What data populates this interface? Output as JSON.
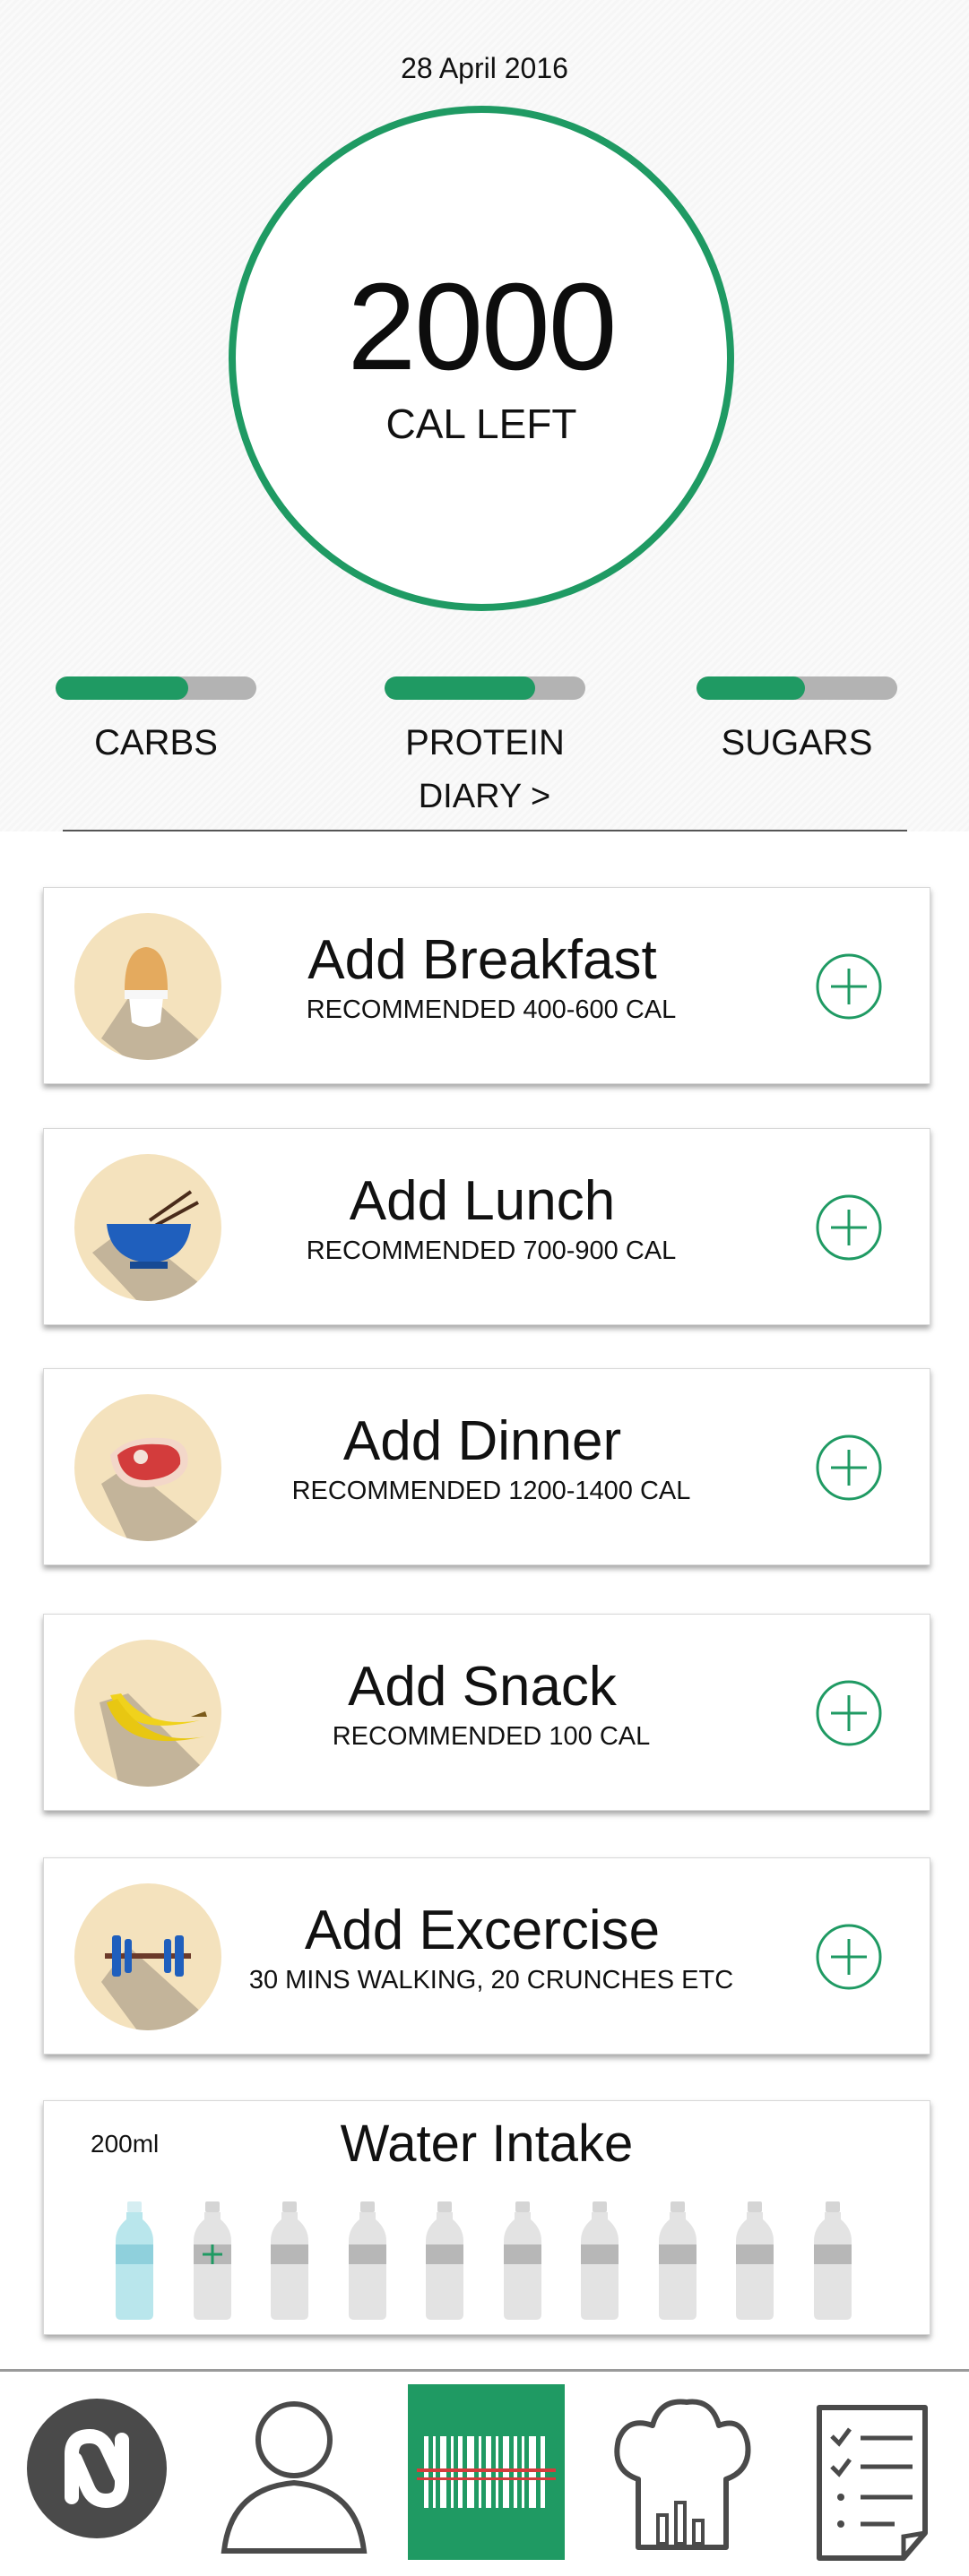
{
  "header": {
    "date": "28 April 2016"
  },
  "calories": {
    "value": "2000",
    "label": "CAL LEFT"
  },
  "macros": [
    {
      "name": "CARBS",
      "progress": 0.66
    },
    {
      "name": "PROTEIN",
      "progress": 0.75
    },
    {
      "name": "SUGARS",
      "progress": 0.54
    }
  ],
  "diary_link": "DIARY >",
  "meals": [
    {
      "title": "Add Breakfast",
      "subtitle": "RECOMMENDED 400-600 CAL",
      "icon": "egg-icon"
    },
    {
      "title": "Add Lunch",
      "subtitle": "RECOMMENDED 700-900 CAL",
      "icon": "bowl-chopsticks-icon"
    },
    {
      "title": "Add Dinner",
      "subtitle": "RECOMMENDED 1200-1400 CAL",
      "icon": "steak-icon"
    },
    {
      "title": "Add Snack",
      "subtitle": "RECOMMENDED 100 CAL",
      "icon": "banana-icon"
    },
    {
      "title": "Add Excercise",
      "subtitle": "30 MINS WALKING, 20 CRUNCHES ETC",
      "icon": "dumbbell-icon"
    }
  ],
  "water": {
    "amount": "200ml",
    "title": "Water Intake",
    "bottles_total": 10,
    "bottles_filled": 1
  },
  "nav": [
    "logo-icon",
    "profile-icon",
    "barcode-scanner-icon",
    "chef-hat-icon",
    "checklist-icon"
  ],
  "colors": {
    "accent": "#1f9a63",
    "icon_bg": "#f4e2bd",
    "track": "#b3b3b3"
  }
}
